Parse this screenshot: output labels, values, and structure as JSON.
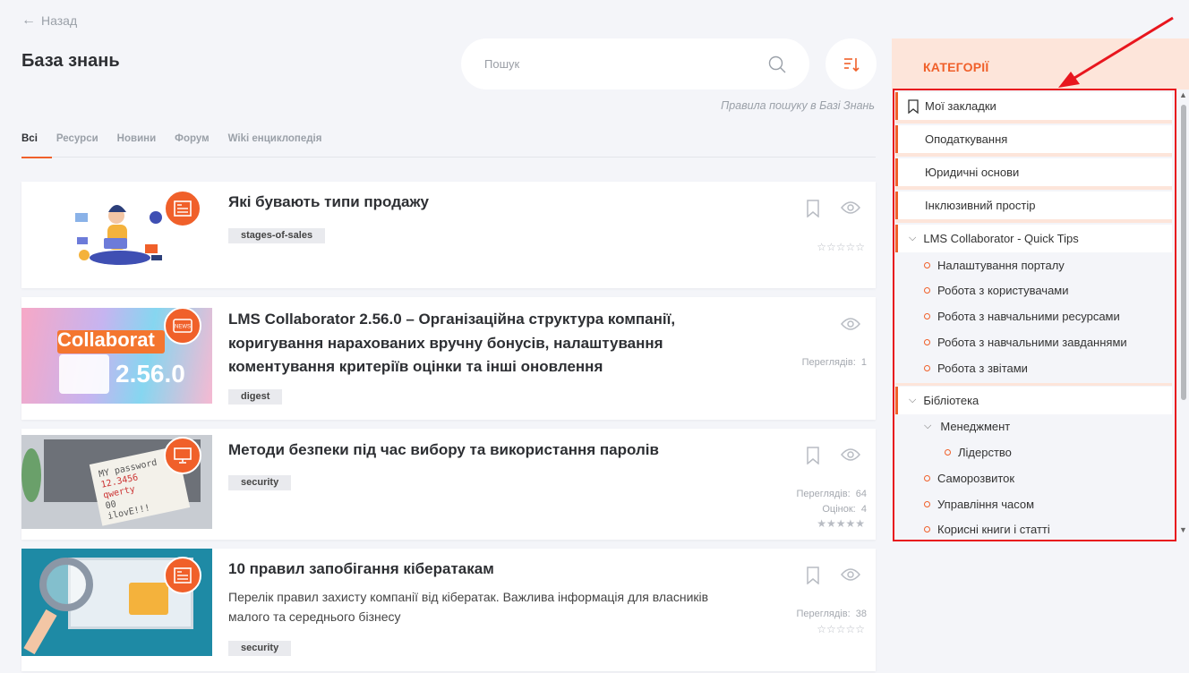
{
  "nav": {
    "back_label": "Назад"
  },
  "header": {
    "title": "База знань"
  },
  "search": {
    "placeholder": "Пошук",
    "rules_link": "Правила пошуку в Базі Знань"
  },
  "tabs": [
    {
      "label": "Всі",
      "active": true
    },
    {
      "label": "Ресурси"
    },
    {
      "label": "Новини"
    },
    {
      "label": "Форум"
    },
    {
      "label": "Wiki енциклопедія"
    }
  ],
  "cards": [
    {
      "title": "Які бувають типи продажу",
      "tag": "stages-of-sales",
      "badge_icon": "article-icon",
      "ratings": "0 of 5"
    },
    {
      "title": "LMS Collaborator 2.56.0 – Організаційна структура компанії, коригування нарахованих вручну бонусів, налаштування коментування критеріїв оцінки та інші оновлення",
      "tag": "digest",
      "badge_icon": "news-icon",
      "thumb_brand": "Collaborat",
      "thumb_version": "2.56.0",
      "views_label": "Переглядів:",
      "views": "1"
    },
    {
      "title": "Методи безпеки під час вибору та використання паролів",
      "tag": "security",
      "badge_icon": "monitor-icon",
      "thumb_note": [
        "MY password",
        "12.3456",
        "qwerty",
        "00",
        "ilovE!!!"
      ],
      "views_label": "Переглядів:",
      "views": "64",
      "ratings_label": "Оцінок:",
      "ratings_count": "4",
      "ratings": "5 of 5"
    },
    {
      "title": "10 правил запобігання кібератакам",
      "desc": "Перелік правил захисту компанії від кібератак. Важлива інформація для власників малого та середнього бізнесу",
      "tag": "security",
      "badge_icon": "article-icon",
      "views_label": "Переглядів:",
      "views": "38",
      "ratings": "0 of 5"
    }
  ],
  "sidebar": {
    "title": "КАТЕГОРІЇ",
    "bookmarks": "Мої закладки",
    "categories": [
      "Оподаткування",
      "Юридичні основи",
      "Інклюзивний простір"
    ],
    "lms_group": {
      "label": "LMS Collaborator - Quick Tips",
      "items": [
        "Налаштування порталу",
        "Робота з користувачами",
        "Робота з навчальними ресурсами",
        "Робота з навчальними завданнями",
        "Робота з звітами"
      ]
    },
    "library_group": {
      "label": "Бібліотека",
      "management": "Менеджмент",
      "management_items": [
        "Лідерство"
      ],
      "items": [
        "Саморозвиток",
        "Управління часом",
        "Корисні книги і статті"
      ]
    }
  },
  "colors": {
    "accent": "#f0602a",
    "sidebar_header_bg": "#fde5da",
    "highlight": "#e8161e",
    "page_bg": "#f4f5f9"
  }
}
